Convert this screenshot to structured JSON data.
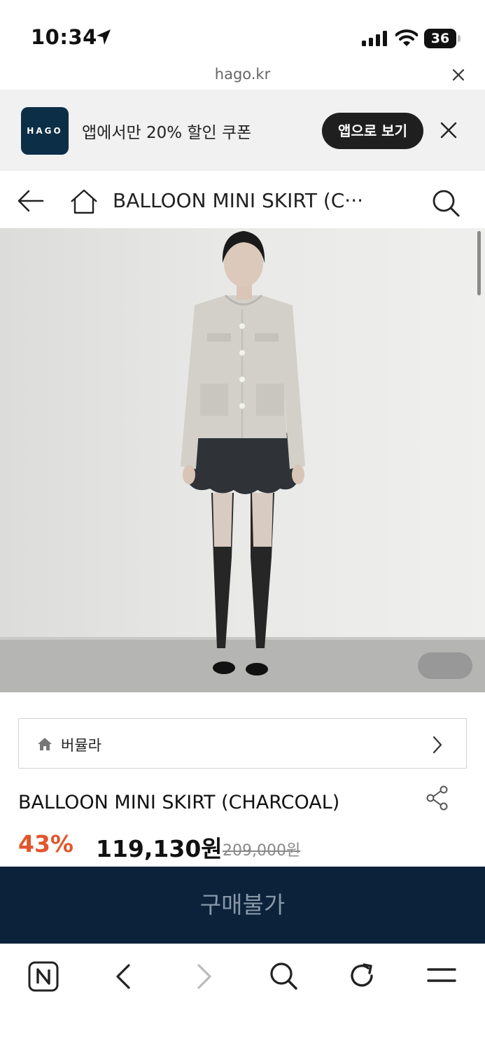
{
  "status_bar": {
    "time": "10:34",
    "battery": "36",
    "icons": [
      "location-arrow-icon",
      "cellular-signal-icon",
      "wifi-icon",
      "battery-icon"
    ]
  },
  "url_bar": {
    "domain": "hago.kr"
  },
  "app_banner": {
    "logo_text": "HAGO",
    "message": "앱에서만 20% 할인 쿠폰",
    "open_app_label": "앱으로 보기"
  },
  "header": {
    "title": "BALLOON MINI SKIRT (C···"
  },
  "brand": {
    "name": "버뮬라"
  },
  "product": {
    "name": "BALLOON MINI SKIRT (CHARCOAL)",
    "discount": "43%",
    "sale_price": "119,130원",
    "original_price": "209,000원"
  },
  "buy_button": {
    "label": "구매불가"
  },
  "colors": {
    "brand_navy": "#0b223a",
    "discount_orange": "#e0562b",
    "banner_bg": "#f1f1f1"
  }
}
